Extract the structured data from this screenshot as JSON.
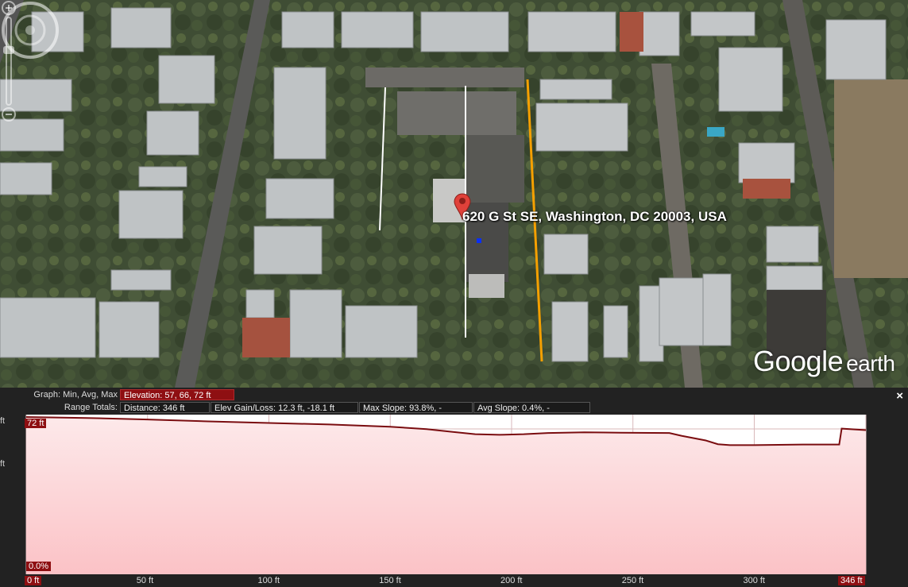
{
  "map": {
    "address": "620 G St SE, Washington, DC 20003, USA",
    "brand_google": "Google",
    "brand_earth": "earth"
  },
  "profile": {
    "graph_label": "Graph: Min, Avg, Max",
    "elevation": "Elevation: 57, 66, 72 ft",
    "range_label": "Range Totals:",
    "distance": "Distance: 346 ft",
    "elev_gain_loss": "Elev Gain/Loss: 12.3 ft, -18.1 ft",
    "max_slope": "Max Slope: 93.8%, -",
    "avg_slope": "Avg Slope: 0.4%, -",
    "close": "×",
    "y_unit_top": "ft",
    "y_unit_mid": "ft",
    "max_marker": "72 ft",
    "slope_marker": "0.0%",
    "x_ticks": [
      "0 ft",
      "50 ft",
      "100 ft",
      "150 ft",
      "200 ft",
      "250 ft",
      "300 ft",
      "346 ft"
    ]
  },
  "chart_data": {
    "type": "area",
    "xlabel": "",
    "ylabel": "",
    "xlim": [
      0,
      346
    ],
    "ylim": [
      57,
      72
    ],
    "x": [
      0,
      25,
      50,
      75,
      100,
      125,
      150,
      165,
      175,
      185,
      195,
      205,
      215,
      230,
      245,
      265,
      270,
      280,
      285,
      290,
      300,
      320,
      335,
      336,
      346
    ],
    "y": [
      72,
      71.7,
      71.2,
      70.6,
      70.1,
      69.6,
      68.9,
      68.1,
      67.3,
      66.5,
      66.3,
      66.5,
      66.9,
      67.1,
      67.0,
      66.9,
      66.0,
      64.5,
      63.3,
      63.0,
      63.0,
      63.2,
      63.2,
      68.3,
      67.8
    ]
  },
  "colors": {
    "accent": "#8e0f12",
    "profile_line": "#7a0d10",
    "path_line": "#f5a000",
    "pin": "#e0413a"
  }
}
